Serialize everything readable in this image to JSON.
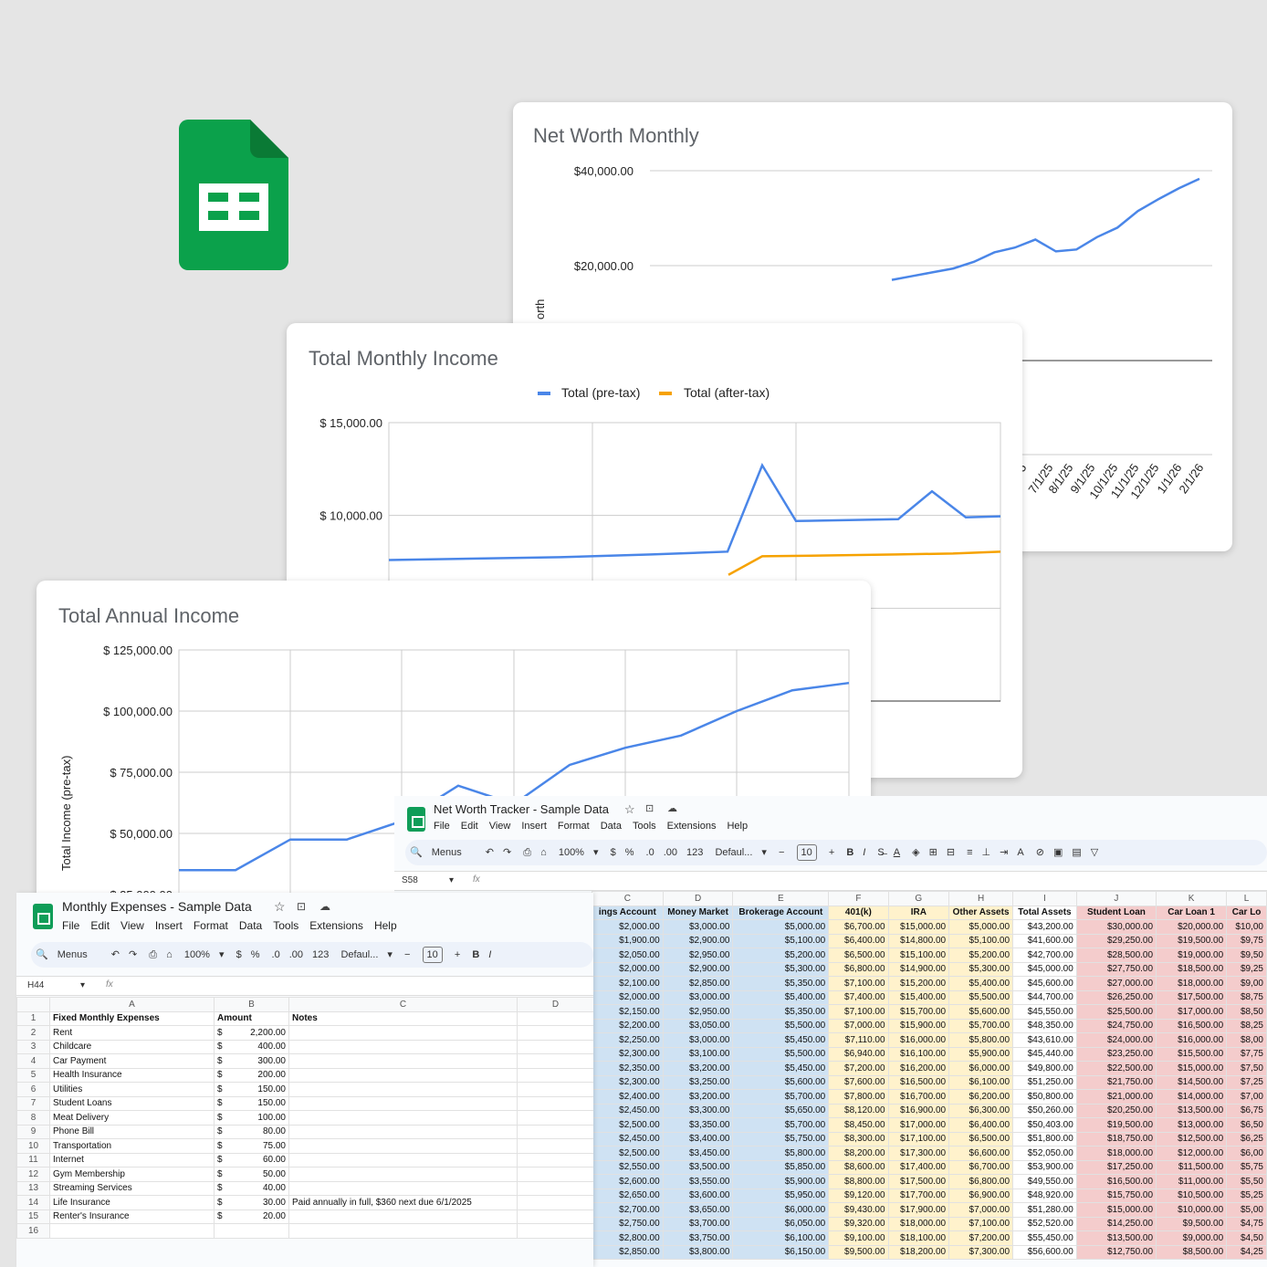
{
  "logo": {
    "name": "google-sheets-logo",
    "color": "#0f9d58"
  },
  "net_worth_chart": {
    "title": "Net Worth Monthly",
    "ylabel_partial": "orth",
    "chart_data": {
      "type": "line",
      "title": "Net Worth Monthly",
      "y_ticks": [
        "$40,000.00",
        "$20,000.00"
      ],
      "x_ticks": [
        "5",
        "7/1/25",
        "8/1/25",
        "9/1/25",
        "10/1/25",
        "11/1/25",
        "12/1/25",
        "1/1/26",
        "2/1/26"
      ],
      "series": [
        {
          "color": "#4a86e8",
          "values": [
            17000,
            17800,
            18600,
            19400,
            20800,
            22800,
            23800,
            25500,
            23000,
            23400,
            26000,
            28000,
            31500,
            34000,
            36300,
            38300
          ]
        }
      ]
    }
  },
  "monthly_income_chart": {
    "title": "Total Monthly Income",
    "chart_data": {
      "type": "line",
      "title": "Total Monthly Income",
      "y_ticks": [
        "$ 15,000.00",
        "$ 10,000.00"
      ],
      "ylim": [
        0,
        15000
      ],
      "series": [
        {
          "name": "Total (pre-tax)",
          "color": "#4a86e8",
          "values": [
            7600,
            7750,
            7900,
            8050,
            12700,
            9700,
            9800,
            11300,
            9900,
            9950
          ]
        },
        {
          "name": "Total (after-tax)",
          "color": "#f6a200",
          "values": [
            6800,
            7800,
            7850,
            7900,
            7950,
            8050
          ]
        }
      ]
    }
  },
  "annual_income_chart": {
    "title": "Total Annual Income",
    "ylabel": "Total Income (pre-tax)",
    "chart_data": {
      "type": "line",
      "title": "Total Annual Income",
      "ylabel": "Total Income (pre-tax)",
      "y_ticks": [
        "$ 125,000.00",
        "$ 100,000.00",
        "$ 75,000.00",
        "$ 50,000.00",
        "$ 25,000.00"
      ],
      "ylim": [
        25000,
        125000
      ],
      "series": [
        {
          "color": "#4a86e8",
          "values": [
            35000,
            35000,
            47500,
            47500,
            55000,
            69500,
            62000,
            78000,
            85000,
            90000,
            100000,
            108500,
            111500
          ]
        }
      ]
    }
  },
  "net_worth_sheet": {
    "title": "Net Worth Tracker - Sample Data",
    "menus": [
      "File",
      "Edit",
      "View",
      "Insert",
      "Format",
      "Data",
      "Tools",
      "Extensions",
      "Help"
    ],
    "toolbar": {
      "search": "Menus",
      "zoom": "100%",
      "font": "Defaul...",
      "size": "10"
    },
    "cell_ref": "S58",
    "col_letters": [
      "C",
      "D",
      "E",
      "F",
      "G",
      "H",
      "I",
      "J",
      "K",
      "L"
    ],
    "headers": [
      "ings Account",
      "Money Market",
      "Brokerage Account",
      "401(k)",
      "IRA",
      "Other Assets",
      "Total Assets",
      "Student Loan",
      "Car Loan 1",
      "Car Lo"
    ],
    "rows": [
      [
        "$2,000.00",
        "$3,000.00",
        "$5,000.00",
        "$6,700.00",
        "$15,000.00",
        "$5,000.00",
        "$43,200.00",
        "$30,000.00",
        "$20,000.00",
        "$10,00"
      ],
      [
        "$1,900.00",
        "$2,900.00",
        "$5,100.00",
        "$6,400.00",
        "$14,800.00",
        "$5,100.00",
        "$41,600.00",
        "$29,250.00",
        "$19,500.00",
        "$9,75"
      ],
      [
        "$2,050.00",
        "$2,950.00",
        "$5,200.00",
        "$6,500.00",
        "$15,100.00",
        "$5,200.00",
        "$42,700.00",
        "$28,500.00",
        "$19,000.00",
        "$9,50"
      ],
      [
        "$2,000.00",
        "$2,900.00",
        "$5,300.00",
        "$6,800.00",
        "$14,900.00",
        "$5,300.00",
        "$45,000.00",
        "$27,750.00",
        "$18,500.00",
        "$9,25"
      ],
      [
        "$2,100.00",
        "$2,850.00",
        "$5,350.00",
        "$7,100.00",
        "$15,200.00",
        "$5,400.00",
        "$45,600.00",
        "$27,000.00",
        "$18,000.00",
        "$9,00"
      ],
      [
        "$2,000.00",
        "$3,000.00",
        "$5,400.00",
        "$7,400.00",
        "$15,400.00",
        "$5,500.00",
        "$44,700.00",
        "$26,250.00",
        "$17,500.00",
        "$8,75"
      ],
      [
        "$2,150.00",
        "$2,950.00",
        "$5,350.00",
        "$7,100.00",
        "$15,700.00",
        "$5,600.00",
        "$45,550.00",
        "$25,500.00",
        "$17,000.00",
        "$8,50"
      ],
      [
        "$2,200.00",
        "$3,050.00",
        "$5,500.00",
        "$7,000.00",
        "$15,900.00",
        "$5,700.00",
        "$48,350.00",
        "$24,750.00",
        "$16,500.00",
        "$8,25"
      ],
      [
        "$2,250.00",
        "$3,000.00",
        "$5,450.00",
        "$7,110.00",
        "$16,000.00",
        "$5,800.00",
        "$43,610.00",
        "$24,000.00",
        "$16,000.00",
        "$8,00"
      ],
      [
        "$2,300.00",
        "$3,100.00",
        "$5,500.00",
        "$6,940.00",
        "$16,100.00",
        "$5,900.00",
        "$45,440.00",
        "$23,250.00",
        "$15,500.00",
        "$7,75"
      ],
      [
        "$2,350.00",
        "$3,200.00",
        "$5,450.00",
        "$7,200.00",
        "$16,200.00",
        "$6,000.00",
        "$49,800.00",
        "$22,500.00",
        "$15,000.00",
        "$7,50"
      ],
      [
        "$2,300.00",
        "$3,250.00",
        "$5,600.00",
        "$7,600.00",
        "$16,500.00",
        "$6,100.00",
        "$51,250.00",
        "$21,750.00",
        "$14,500.00",
        "$7,25"
      ],
      [
        "$2,400.00",
        "$3,200.00",
        "$5,700.00",
        "$7,800.00",
        "$16,700.00",
        "$6,200.00",
        "$50,800.00",
        "$21,000.00",
        "$14,000.00",
        "$7,00"
      ],
      [
        "$2,450.00",
        "$3,300.00",
        "$5,650.00",
        "$8,120.00",
        "$16,900.00",
        "$6,300.00",
        "$50,260.00",
        "$20,250.00",
        "$13,500.00",
        "$6,75"
      ],
      [
        "$2,500.00",
        "$3,350.00",
        "$5,700.00",
        "$8,450.00",
        "$17,000.00",
        "$6,400.00",
        "$50,403.00",
        "$19,500.00",
        "$13,000.00",
        "$6,50"
      ],
      [
        "$2,450.00",
        "$3,400.00",
        "$5,750.00",
        "$8,300.00",
        "$17,100.00",
        "$6,500.00",
        "$51,800.00",
        "$18,750.00",
        "$12,500.00",
        "$6,25"
      ],
      [
        "$2,500.00",
        "$3,450.00",
        "$5,800.00",
        "$8,200.00",
        "$17,300.00",
        "$6,600.00",
        "$52,050.00",
        "$18,000.00",
        "$12,000.00",
        "$6,00"
      ],
      [
        "$2,550.00",
        "$3,500.00",
        "$5,850.00",
        "$8,600.00",
        "$17,400.00",
        "$6,700.00",
        "$53,900.00",
        "$17,250.00",
        "$11,500.00",
        "$5,75"
      ],
      [
        "$2,600.00",
        "$3,550.00",
        "$5,900.00",
        "$8,800.00",
        "$17,500.00",
        "$6,800.00",
        "$49,550.00",
        "$16,500.00",
        "$11,000.00",
        "$5,50"
      ],
      [
        "$2,650.00",
        "$3,600.00",
        "$5,950.00",
        "$9,120.00",
        "$17,700.00",
        "$6,900.00",
        "$48,920.00",
        "$15,750.00",
        "$10,500.00",
        "$5,25"
      ],
      [
        "$2,700.00",
        "$3,650.00",
        "$6,000.00",
        "$9,430.00",
        "$17,900.00",
        "$7,000.00",
        "$51,280.00",
        "$15,000.00",
        "$10,000.00",
        "$5,00"
      ],
      [
        "$2,750.00",
        "$3,700.00",
        "$6,050.00",
        "$9,320.00",
        "$18,000.00",
        "$7,100.00",
        "$52,520.00",
        "$14,250.00",
        "$9,500.00",
        "$4,75"
      ],
      [
        "$2,800.00",
        "$3,750.00",
        "$6,100.00",
        "$9,100.00",
        "$18,100.00",
        "$7,200.00",
        "$55,450.00",
        "$13,500.00",
        "$9,000.00",
        "$4,50"
      ],
      [
        "$2,850.00",
        "$3,800.00",
        "$6,150.00",
        "$9,500.00",
        "$18,200.00",
        "$7,300.00",
        "$56,600.00",
        "$12,750.00",
        "$8,500.00",
        "$4,25"
      ]
    ]
  },
  "expenses_sheet": {
    "title": "Monthly Expenses - Sample Data",
    "menus": [
      "File",
      "Edit",
      "View",
      "Insert",
      "Format",
      "Data",
      "Tools",
      "Extensions",
      "Help"
    ],
    "toolbar": {
      "search": "Menus",
      "zoom": "100%",
      "font": "Defaul...",
      "size": "10"
    },
    "cell_ref": "H44",
    "col_letters": [
      "A",
      "B",
      "C",
      "D"
    ],
    "header": {
      "a": "Fixed Monthly Expenses",
      "b": "Amount",
      "c": "Notes"
    },
    "rows": [
      {
        "n": "2",
        "a": "Rent",
        "cur": "$",
        "b": "2,200.00",
        "c": ""
      },
      {
        "n": "3",
        "a": "Childcare",
        "cur": "$",
        "b": "400.00",
        "c": ""
      },
      {
        "n": "4",
        "a": "Car Payment",
        "cur": "$",
        "b": "300.00",
        "c": ""
      },
      {
        "n": "5",
        "a": "Health Insurance",
        "cur": "$",
        "b": "200.00",
        "c": ""
      },
      {
        "n": "6",
        "a": "Utilities",
        "cur": "$",
        "b": "150.00",
        "c": ""
      },
      {
        "n": "7",
        "a": "Student Loans",
        "cur": "$",
        "b": "150.00",
        "c": ""
      },
      {
        "n": "8",
        "a": "Meat Delivery",
        "cur": "$",
        "b": "100.00",
        "c": ""
      },
      {
        "n": "9",
        "a": "Phone Bill",
        "cur": "$",
        "b": "80.00",
        "c": ""
      },
      {
        "n": "10",
        "a": "Transportation",
        "cur": "$",
        "b": "75.00",
        "c": ""
      },
      {
        "n": "11",
        "a": "Internet",
        "cur": "$",
        "b": "60.00",
        "c": ""
      },
      {
        "n": "12",
        "a": "Gym Membership",
        "cur": "$",
        "b": "50.00",
        "c": ""
      },
      {
        "n": "13",
        "a": "Streaming Services",
        "cur": "$",
        "b": "40.00",
        "c": ""
      },
      {
        "n": "14",
        "a": "Life Insurance",
        "cur": "$",
        "b": "30.00",
        "c": "Paid annually in full, $360 next due 6/1/2025"
      },
      {
        "n": "15",
        "a": "Renter's Insurance",
        "cur": "$",
        "b": "20.00",
        "c": ""
      },
      {
        "n": "16",
        "a": "",
        "cur": "",
        "b": "",
        "c": ""
      }
    ]
  }
}
